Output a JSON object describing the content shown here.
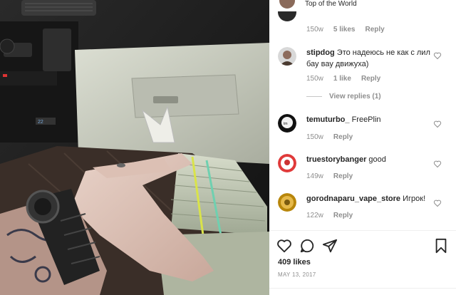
{
  "post": {
    "caption_tail": "Top of the World",
    "likes": "409 likes",
    "date": "MAY 13, 2017"
  },
  "top_comment_meta": {
    "time": "150w",
    "likes": "5 likes",
    "reply": "Reply"
  },
  "comments": [
    {
      "user": "stipdog",
      "text": "Это надеюсь не как с лил бау вау движуха)",
      "time": "150w",
      "likes": "1 like",
      "reply": "Reply",
      "view_replies": "View replies (1)"
    },
    {
      "user": "temuturbo_",
      "text": "FreePlin",
      "time": "150w",
      "reply": "Reply"
    },
    {
      "user": "truestorybanger",
      "text": "good",
      "time": "149w",
      "reply": "Reply"
    },
    {
      "user": "gorodnaparu_vape_store",
      "text": "Игрок!",
      "time": "122w",
      "reply": "Reply"
    }
  ],
  "icons": {
    "like": "heart-icon",
    "comment": "comment-icon",
    "share": "paper-plane-icon",
    "save": "bookmark-icon"
  },
  "colors": {
    "text": "#262626",
    "muted": "#8e8e8e",
    "border": "#efefef"
  }
}
